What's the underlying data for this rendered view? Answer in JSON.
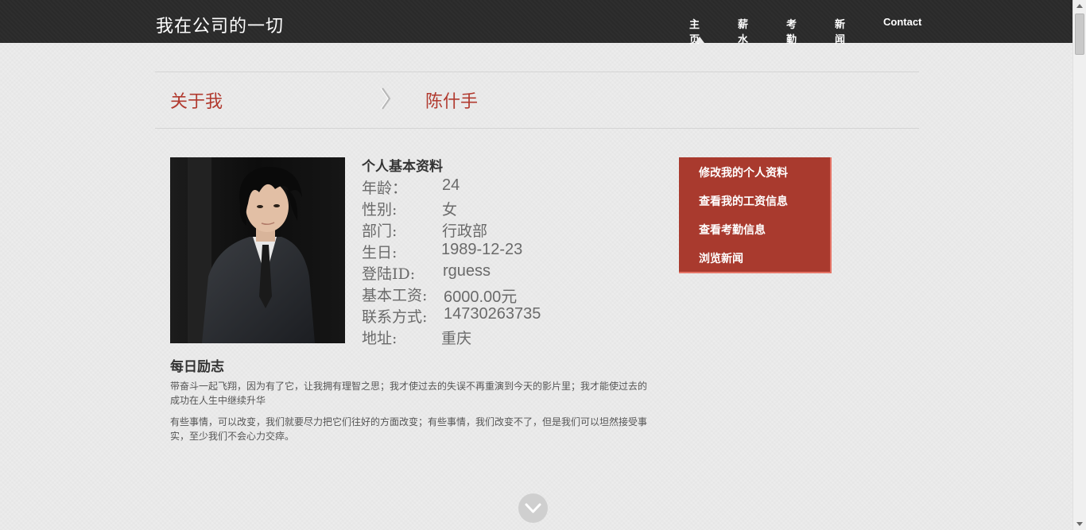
{
  "header": {
    "site_title": "我在公司的一切",
    "nav": [
      {
        "label": "主页",
        "active": true
      },
      {
        "label": "薪水"
      },
      {
        "label": "考勤"
      },
      {
        "label": "新闻"
      },
      {
        "label": "Contact"
      }
    ]
  },
  "breadcrumb": {
    "section": "关于我",
    "name": "陈什手"
  },
  "profile": {
    "title": "个人基本资料",
    "photo_icon": "user-portrait",
    "fields": [
      {
        "label": "年龄：",
        "value": "24"
      },
      {
        "label": "性别:",
        "value": "女"
      },
      {
        "label": "部门:",
        "value": "行政部"
      },
      {
        "label": "生日:",
        "value": "1989-12-23"
      },
      {
        "label": "登陆ID:",
        "value": "rguess"
      },
      {
        "label": "基本工资:",
        "value": "6000.00元"
      },
      {
        "label": "联系方式:",
        "value": "14730263735"
      },
      {
        "label": "地址:",
        "value": "重庆"
      }
    ]
  },
  "motto": {
    "title": "每日励志",
    "paragraphs": [
      "带奋斗一起飞翔，因为有了它，让我拥有理智之思；我才使过去的失误不再重演到今天的影片里；我才能使过去的成功在人生中继续升华",
      "有些事情，可以改变，我们就要尽力把它们往好的方面改变；有些事情，我们改变不了，但是我们可以坦然接受事实，至少我们不会心力交瘁。"
    ]
  },
  "side_menu": {
    "items": [
      {
        "label": "修改我的个人资料"
      },
      {
        "label": "查看我的工资信息"
      },
      {
        "label": "查看考勤信息"
      },
      {
        "label": "浏览新闻"
      }
    ]
  },
  "colors": {
    "accent": "#a93a2e",
    "crumb": "#b13a2f",
    "header_bg": "#2b2b2b",
    "page_bg": "#ececec"
  }
}
